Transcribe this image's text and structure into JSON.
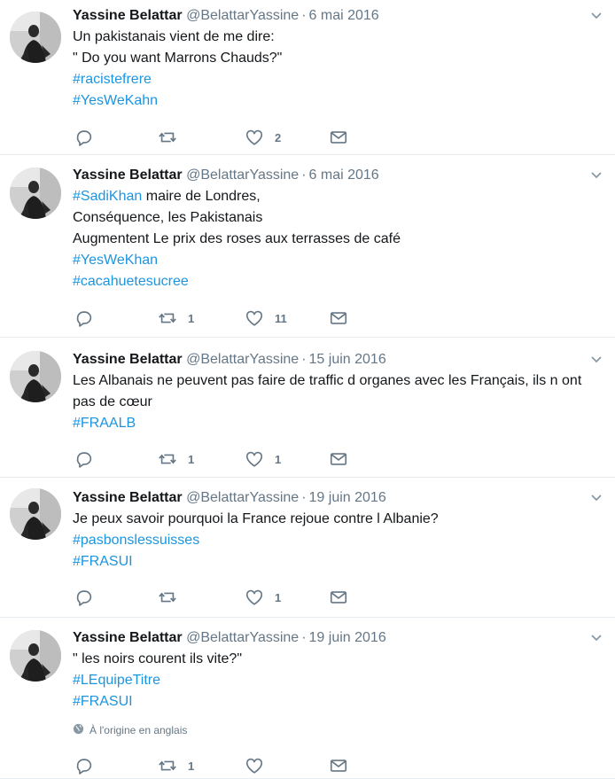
{
  "tweets": [
    {
      "name": "Yassine Belattar",
      "handle": "@BelattarYassine",
      "separator": "·",
      "date": "6 mai 2016",
      "lines": [
        {
          "text": "Un pakistanais vient de me dire:",
          "hashtag": "",
          "rest": ""
        },
        {
          "text": "\" Do you want Marrons Chauds?\"",
          "hashtag": "",
          "rest": ""
        },
        {
          "text": "",
          "hashtag": "#racistefrere",
          "rest": ""
        },
        {
          "text": "",
          "hashtag": "#YesWeKahn",
          "rest": ""
        }
      ],
      "translation_note": "",
      "reply_count": "",
      "retweet_count": "",
      "like_count": "2"
    },
    {
      "name": "Yassine Belattar",
      "handle": "@BelattarYassine",
      "separator": "·",
      "date": "6 mai 2016",
      "lines": [
        {
          "text": "",
          "hashtag": "#SadiKhan",
          "rest": " maire de Londres,"
        },
        {
          "text": "Conséquence, les Pakistanais",
          "hashtag": "",
          "rest": ""
        },
        {
          "text": "Augmentent Le prix des roses  aux terrasses de café",
          "hashtag": "",
          "rest": ""
        },
        {
          "text": "",
          "hashtag": "#YesWeKhan",
          "rest": ""
        },
        {
          "text": "",
          "hashtag": "#cacahuetesucree",
          "rest": ""
        }
      ],
      "translation_note": "",
      "reply_count": "",
      "retweet_count": "1",
      "like_count": "11"
    },
    {
      "name": "Yassine Belattar",
      "handle": "@BelattarYassine",
      "separator": "·",
      "date": "15 juin 2016",
      "lines": [
        {
          "text": "Les Albanais ne peuvent pas faire de traffic d organes avec les Français, ils n ont",
          "hashtag": "",
          "rest": ""
        },
        {
          "text": "pas de cœur",
          "hashtag": "",
          "rest": ""
        },
        {
          "text": "",
          "hashtag": "#FRAALB",
          "rest": ""
        }
      ],
      "translation_note": "",
      "reply_count": "",
      "retweet_count": "1",
      "like_count": "1"
    },
    {
      "name": "Yassine Belattar",
      "handle": "@BelattarYassine",
      "separator": "·",
      "date": "19 juin 2016",
      "lines": [
        {
          "text": "Je peux savoir pourquoi la France rejoue contre l Albanie?",
          "hashtag": "",
          "rest": ""
        },
        {
          "text": "",
          "hashtag": "#pasbonslessuisses",
          "rest": ""
        },
        {
          "text": "",
          "hashtag": "#FRASUI",
          "rest": ""
        }
      ],
      "translation_note": "",
      "reply_count": "",
      "retweet_count": "",
      "like_count": "1"
    },
    {
      "name": "Yassine Belattar",
      "handle": "@BelattarYassine",
      "separator": "·",
      "date": "19 juin 2016",
      "lines": [
        {
          "text": "\" les noirs courent ils vite?\"",
          "hashtag": "",
          "rest": ""
        },
        {
          "text": "",
          "hashtag": "#LEquipeTitre",
          "rest": ""
        },
        {
          "text": "",
          "hashtag": "#FRASUI",
          "rest": ""
        }
      ],
      "translation_note": "À l'origine en anglais",
      "reply_count": "",
      "retweet_count": "1",
      "like_count": ""
    }
  ],
  "icons": {
    "reply": "reply-icon",
    "retweet": "retweet-icon",
    "like": "heart-icon",
    "message": "envelope-icon",
    "more": "chevron-down-icon",
    "globe": "globe-icon"
  },
  "colors": {
    "hashtag": "#1b95e0",
    "muted": "#657786",
    "text": "#14171a",
    "divider": "#e6ecf0"
  }
}
